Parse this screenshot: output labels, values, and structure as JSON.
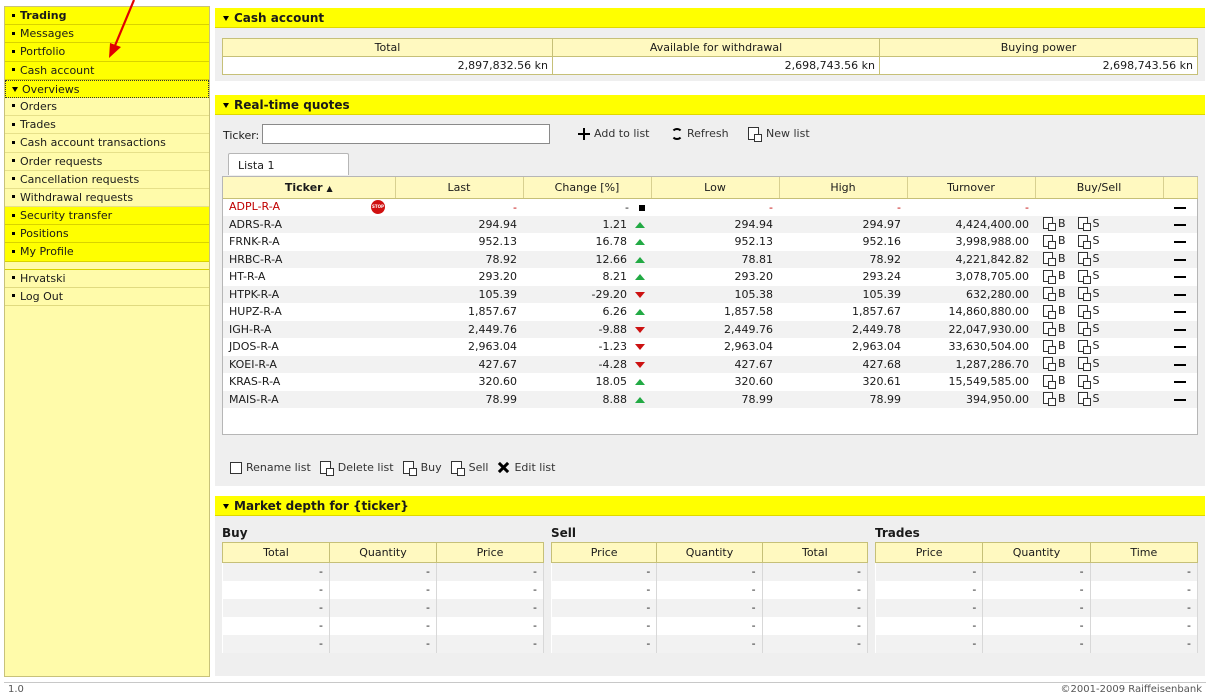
{
  "sidebar": {
    "items": [
      {
        "label": "Trading",
        "bold": true
      },
      {
        "label": "Messages"
      },
      {
        "label": "Portfolio"
      },
      {
        "label": "Cash account"
      },
      {
        "label": "Overviews",
        "expanded": true
      },
      {
        "label": "Orders"
      },
      {
        "label": "Trades"
      },
      {
        "label": "Cash account transactions"
      },
      {
        "label": "Order requests"
      },
      {
        "label": "Cancellation requests"
      },
      {
        "label": "Withdrawal requests"
      },
      {
        "label": "Security transfer"
      },
      {
        "label": "Positions"
      },
      {
        "label": "My Profile"
      }
    ],
    "language": "Hrvatski",
    "logout": "Log Out"
  },
  "cash": {
    "title": "Cash account",
    "headers": [
      "Total",
      "Available for withdrawal",
      "Buying power"
    ],
    "values": [
      "2,897,832.56 kn",
      "2,698,743.56 kn",
      "2,698,743.56 kn"
    ]
  },
  "quotes": {
    "title": "Real-time quotes",
    "ticker_label": "Ticker:",
    "ticker_value": "",
    "add_label": "Add to list",
    "refresh_label": "Refresh",
    "new_list_label": "New list",
    "tab": "Lista 1",
    "headers": [
      "Ticker",
      "Last",
      "Change [%]",
      "Low",
      "High",
      "Turnover",
      "Buy/Sell"
    ],
    "rows": [
      {
        "ticker": "ADPL-R-A",
        "halted": true,
        "last": "-",
        "change": "-",
        "dir": "flat",
        "low": "-",
        "high": "-",
        "turnover": "-"
      },
      {
        "ticker": "ADRS-R-A",
        "last": "294.94",
        "change": "1.21",
        "dir": "up",
        "low": "294.94",
        "high": "294.97",
        "turnover": "4,424,400.00"
      },
      {
        "ticker": "FRNK-R-A",
        "last": "952.13",
        "change": "16.78",
        "dir": "up",
        "low": "952.13",
        "high": "952.16",
        "turnover": "3,998,988.00"
      },
      {
        "ticker": "HRBC-R-A",
        "last": "78.92",
        "change": "12.66",
        "dir": "up",
        "low": "78.81",
        "high": "78.92",
        "turnover": "4,221,842.82"
      },
      {
        "ticker": "HT-R-A",
        "last": "293.20",
        "change": "8.21",
        "dir": "up",
        "low": "293.20",
        "high": "293.24",
        "turnover": "3,078,705.00"
      },
      {
        "ticker": "HTPK-R-A",
        "last": "105.39",
        "change": "-29.20",
        "dir": "down",
        "low": "105.38",
        "high": "105.39",
        "turnover": "632,280.00"
      },
      {
        "ticker": "HUPZ-R-A",
        "last": "1,857.67",
        "change": "6.26",
        "dir": "up",
        "low": "1,857.58",
        "high": "1,857.67",
        "turnover": "14,860,880.00"
      },
      {
        "ticker": "IGH-R-A",
        "last": "2,449.76",
        "change": "-9.88",
        "dir": "down",
        "low": "2,449.76",
        "high": "2,449.78",
        "turnover": "22,047,930.00"
      },
      {
        "ticker": "JDOS-R-A",
        "last": "2,963.04",
        "change": "-1.23",
        "dir": "down",
        "low": "2,963.04",
        "high": "2,963.04",
        "turnover": "33,630,504.00"
      },
      {
        "ticker": "KOEI-R-A",
        "last": "427.67",
        "change": "-4.28",
        "dir": "down",
        "low": "427.67",
        "high": "427.68",
        "turnover": "1,287,286.70"
      },
      {
        "ticker": "KRAS-R-A",
        "last": "320.60",
        "change": "18.05",
        "dir": "up",
        "low": "320.60",
        "high": "320.61",
        "turnover": "15,549,585.00"
      },
      {
        "ticker": "MAIS-R-A",
        "last": "78.99",
        "change": "8.88",
        "dir": "up",
        "low": "78.99",
        "high": "78.99",
        "turnover": "394,950.00"
      }
    ],
    "buy_label": "B",
    "sell_label": "S",
    "stop_label": "STOP",
    "tools": [
      "Rename list",
      "Delete list",
      "Buy",
      "Sell",
      "Edit list"
    ]
  },
  "depth": {
    "title": "Market depth for {ticker}",
    "sections": [
      {
        "title": "Buy",
        "headers": [
          "Total",
          "Quantity",
          "Price"
        ]
      },
      {
        "title": "Sell",
        "headers": [
          "Price",
          "Quantity",
          "Total"
        ]
      },
      {
        "title": "Trades",
        "headers": [
          "Price",
          "Quantity",
          "Time"
        ]
      }
    ],
    "empty": "-"
  },
  "footer": {
    "version": "1.0",
    "copyright": "©2001-2009 Raiffeisenbank"
  },
  "colors": {
    "accent": "#ffff00",
    "sidebar_bg": "#fffbaa",
    "up": "#22aa44",
    "down": "#cc1111",
    "halted": "#c00000",
    "arrow": "#e00000"
  }
}
